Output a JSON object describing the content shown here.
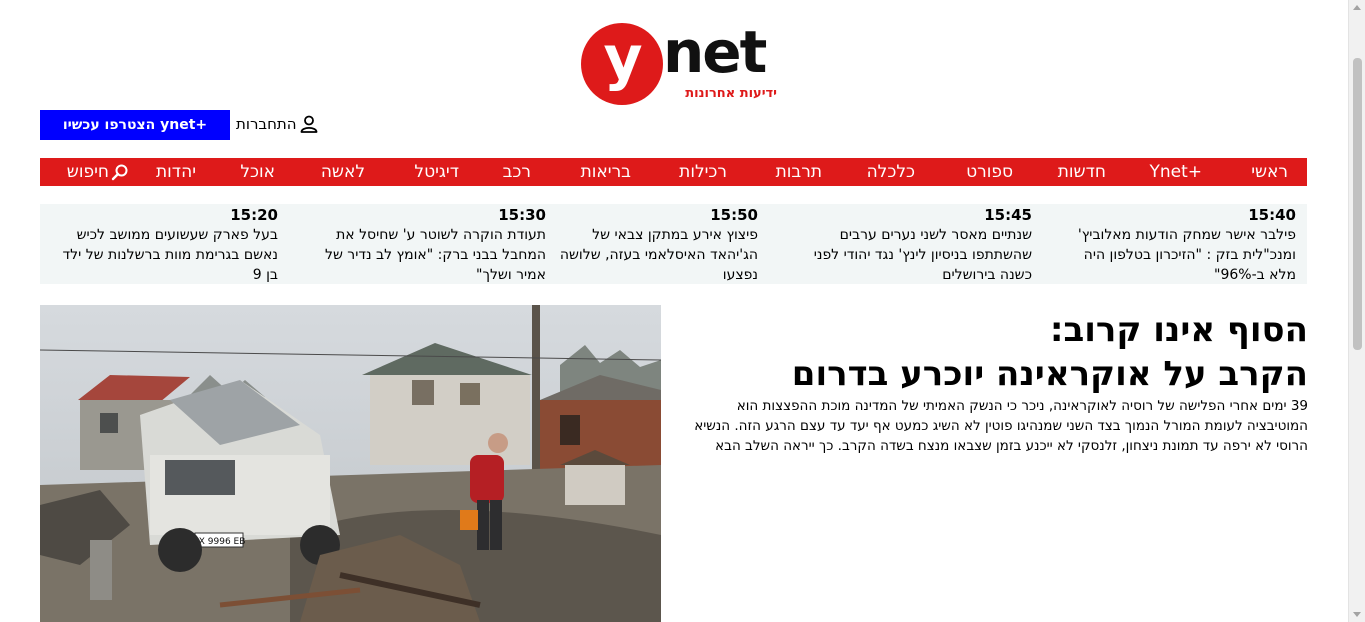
{
  "brand": {
    "logo_letter": "y",
    "logo_word": "net",
    "tagline": "ידיעות אחרונות",
    "accent_color": "#de1a1a",
    "join_color": "#0000ff"
  },
  "header": {
    "join_button": "+ynet הצטרפו עכשיו",
    "login_label": "התחברות",
    "login_icon": "user-icon"
  },
  "nav": {
    "items": [
      "ראשי",
      "+Ynet",
      "חדשות",
      "ספורט",
      "כלכלה",
      "תרבות",
      "רכילות",
      "בריאות",
      "רכב",
      "דיגיטל",
      "לאשה",
      "אוכל",
      "יהדות"
    ],
    "search_label": "חיפוש",
    "search_icon": "search-icon"
  },
  "ticker": [
    {
      "time": "15:40",
      "text": "פילבר אישר שמחק הודעות מאלוביץ' ומנכ\"לית בזק : \"הזיכרון בטלפון היה מלא ב-96%\""
    },
    {
      "time": "15:45",
      "text": "שנתיים מאסר לשני נערים ערבים שהשתתפו בניסיון לינץ' נגד יהודי לפני כשנה בירושלים"
    },
    {
      "time": "15:50",
      "text": "פיצוץ אירע במתקן צבאי של הג'יהאד האיסלאמי בעזה, שלושה נפצעו"
    },
    {
      "time": "15:30",
      "text": "תעודת הוקרה לשוטר ע' שחיסל את המחבל בבני ברק: \"אומץ לב נדיר של אמיר ושלך\""
    },
    {
      "time": "15:20",
      "text": "בעל פארק שעשועים ממושב לכיש נאשם בגרימת מוות ברשלנות של ילד בן 9"
    }
  ],
  "main": {
    "title_line1": "הסוף אינו קרוב:",
    "title_line2": "הקרב על אוקראינה יוכרע בדרום",
    "subtitle": "39 ימים אחרי הפלישה של רוסיה לאוקראינה, ניכר כי הנשק האמיתי של המדינה מוכת ההפצצות הוא המוטיבציה לעומת המורל הנמוך בצד השני שמנהיגו פוטין לא השיג כמעט אף יעד עד עצם הרגע הזה. הנשיא הרוסי לא ירפה עד תמונת ניצחון, זלנסקי לא ייכנע בזמן שצבאו מנצח בשדה הקרב. כך ייראה השלב הבא",
    "van_plate": "AX 9996 EB"
  }
}
